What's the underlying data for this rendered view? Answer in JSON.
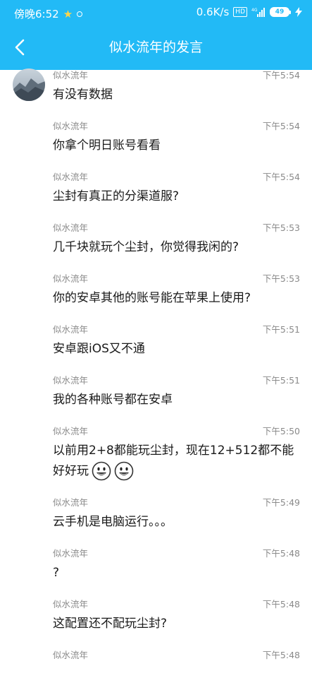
{
  "status_bar": {
    "time": "傍晚6:52",
    "speed": "0.6K/s",
    "hd": "HD",
    "battery": "49",
    "network": "4G"
  },
  "header": {
    "title": "似水流年的发言"
  },
  "messages": [
    {
      "author": "似水流年",
      "time": "下午5:54",
      "text": "有没有数据"
    },
    {
      "author": "似水流年",
      "time": "下午5:54",
      "text": "你拿个明日账号看看"
    },
    {
      "author": "似水流年",
      "time": "下午5:54",
      "text": "尘封有真正的分渠道服?"
    },
    {
      "author": "似水流年",
      "time": "下午5:53",
      "text": "几千块就玩个尘封，你觉得我闲的?"
    },
    {
      "author": "似水流年",
      "time": "下午5:53",
      "text": "你的安卓其他的账号能在苹果上使用?"
    },
    {
      "author": "似水流年",
      "time": "下午5:51",
      "text": "安卓跟iOS又不通"
    },
    {
      "author": "似水流年",
      "time": "下午5:51",
      "text": "我的各种账号都在安卓"
    },
    {
      "author": "似水流年",
      "time": "下午5:50",
      "text": "以前用2+8都能玩尘封，现在12+512都不能好好玩"
    },
    {
      "author": "似水流年",
      "time": "下午5:49",
      "text": "云手机是电脑运行。。。"
    },
    {
      "author": "似水流年",
      "time": "下午5:48",
      "text": "?"
    },
    {
      "author": "似水流年",
      "time": "下午5:48",
      "text": "这配置还不配玩尘封?"
    },
    {
      "author": "似水流年",
      "time": "下午5:48",
      "text": ""
    }
  ],
  "colors": {
    "accent": "#22baf6",
    "meta_text": "#8a8a8a",
    "body_text": "#1a1a1a"
  },
  "icons": {
    "back": "chevron-left-icon",
    "status_star": "star-icon",
    "emoji": "grinning-face-icon"
  }
}
